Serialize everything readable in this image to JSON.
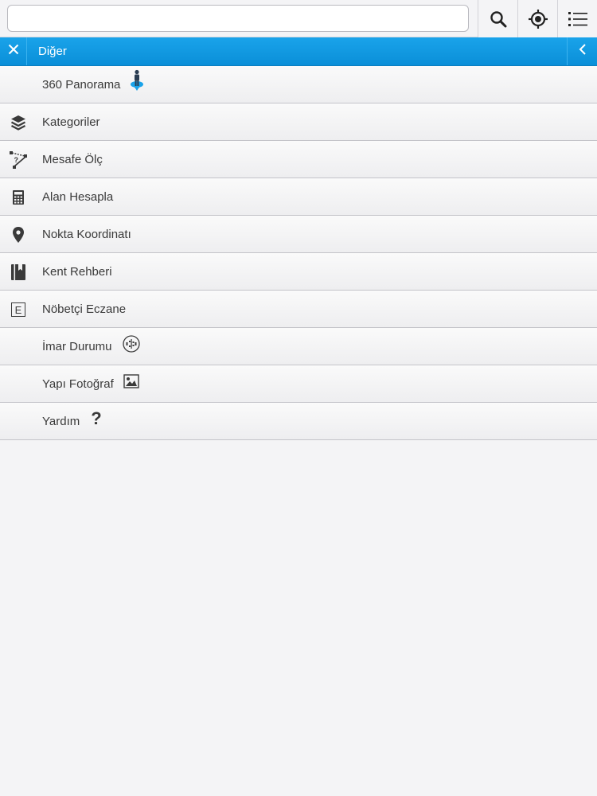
{
  "search": {
    "value": "",
    "placeholder": ""
  },
  "toolbar": {
    "search_icon": "search-icon",
    "locate_icon": "crosshair-locate-icon",
    "list_icon": "list-menu-icon"
  },
  "panel": {
    "title": "Diğer",
    "accent_color": "#0a8fd8"
  },
  "menu": {
    "items": [
      {
        "label": "360 Panorama",
        "icon": "street-view-person-icon"
      },
      {
        "label": "Kategoriler",
        "icon": "layers-icon"
      },
      {
        "label": "Mesafe Ölç",
        "icon": "measure-distance-icon"
      },
      {
        "label": "Alan Hesapla",
        "icon": "calculator-icon"
      },
      {
        "label": "Nokta Koordinatı",
        "icon": "map-pin-icon"
      },
      {
        "label": "Kent Rehberi",
        "icon": "city-guide-book-icon"
      },
      {
        "label": "Nöbetçi Eczane",
        "icon": "pharmacy-e-icon",
        "icon_text": "E"
      },
      {
        "label": "İmar Durumu",
        "icon": "zoning-plan-icon"
      },
      {
        "label": "Yapı Fotoğraf",
        "icon": "photo-icon"
      },
      {
        "label": "Yardım",
        "icon": "help-question-icon",
        "icon_text": "?"
      }
    ]
  }
}
